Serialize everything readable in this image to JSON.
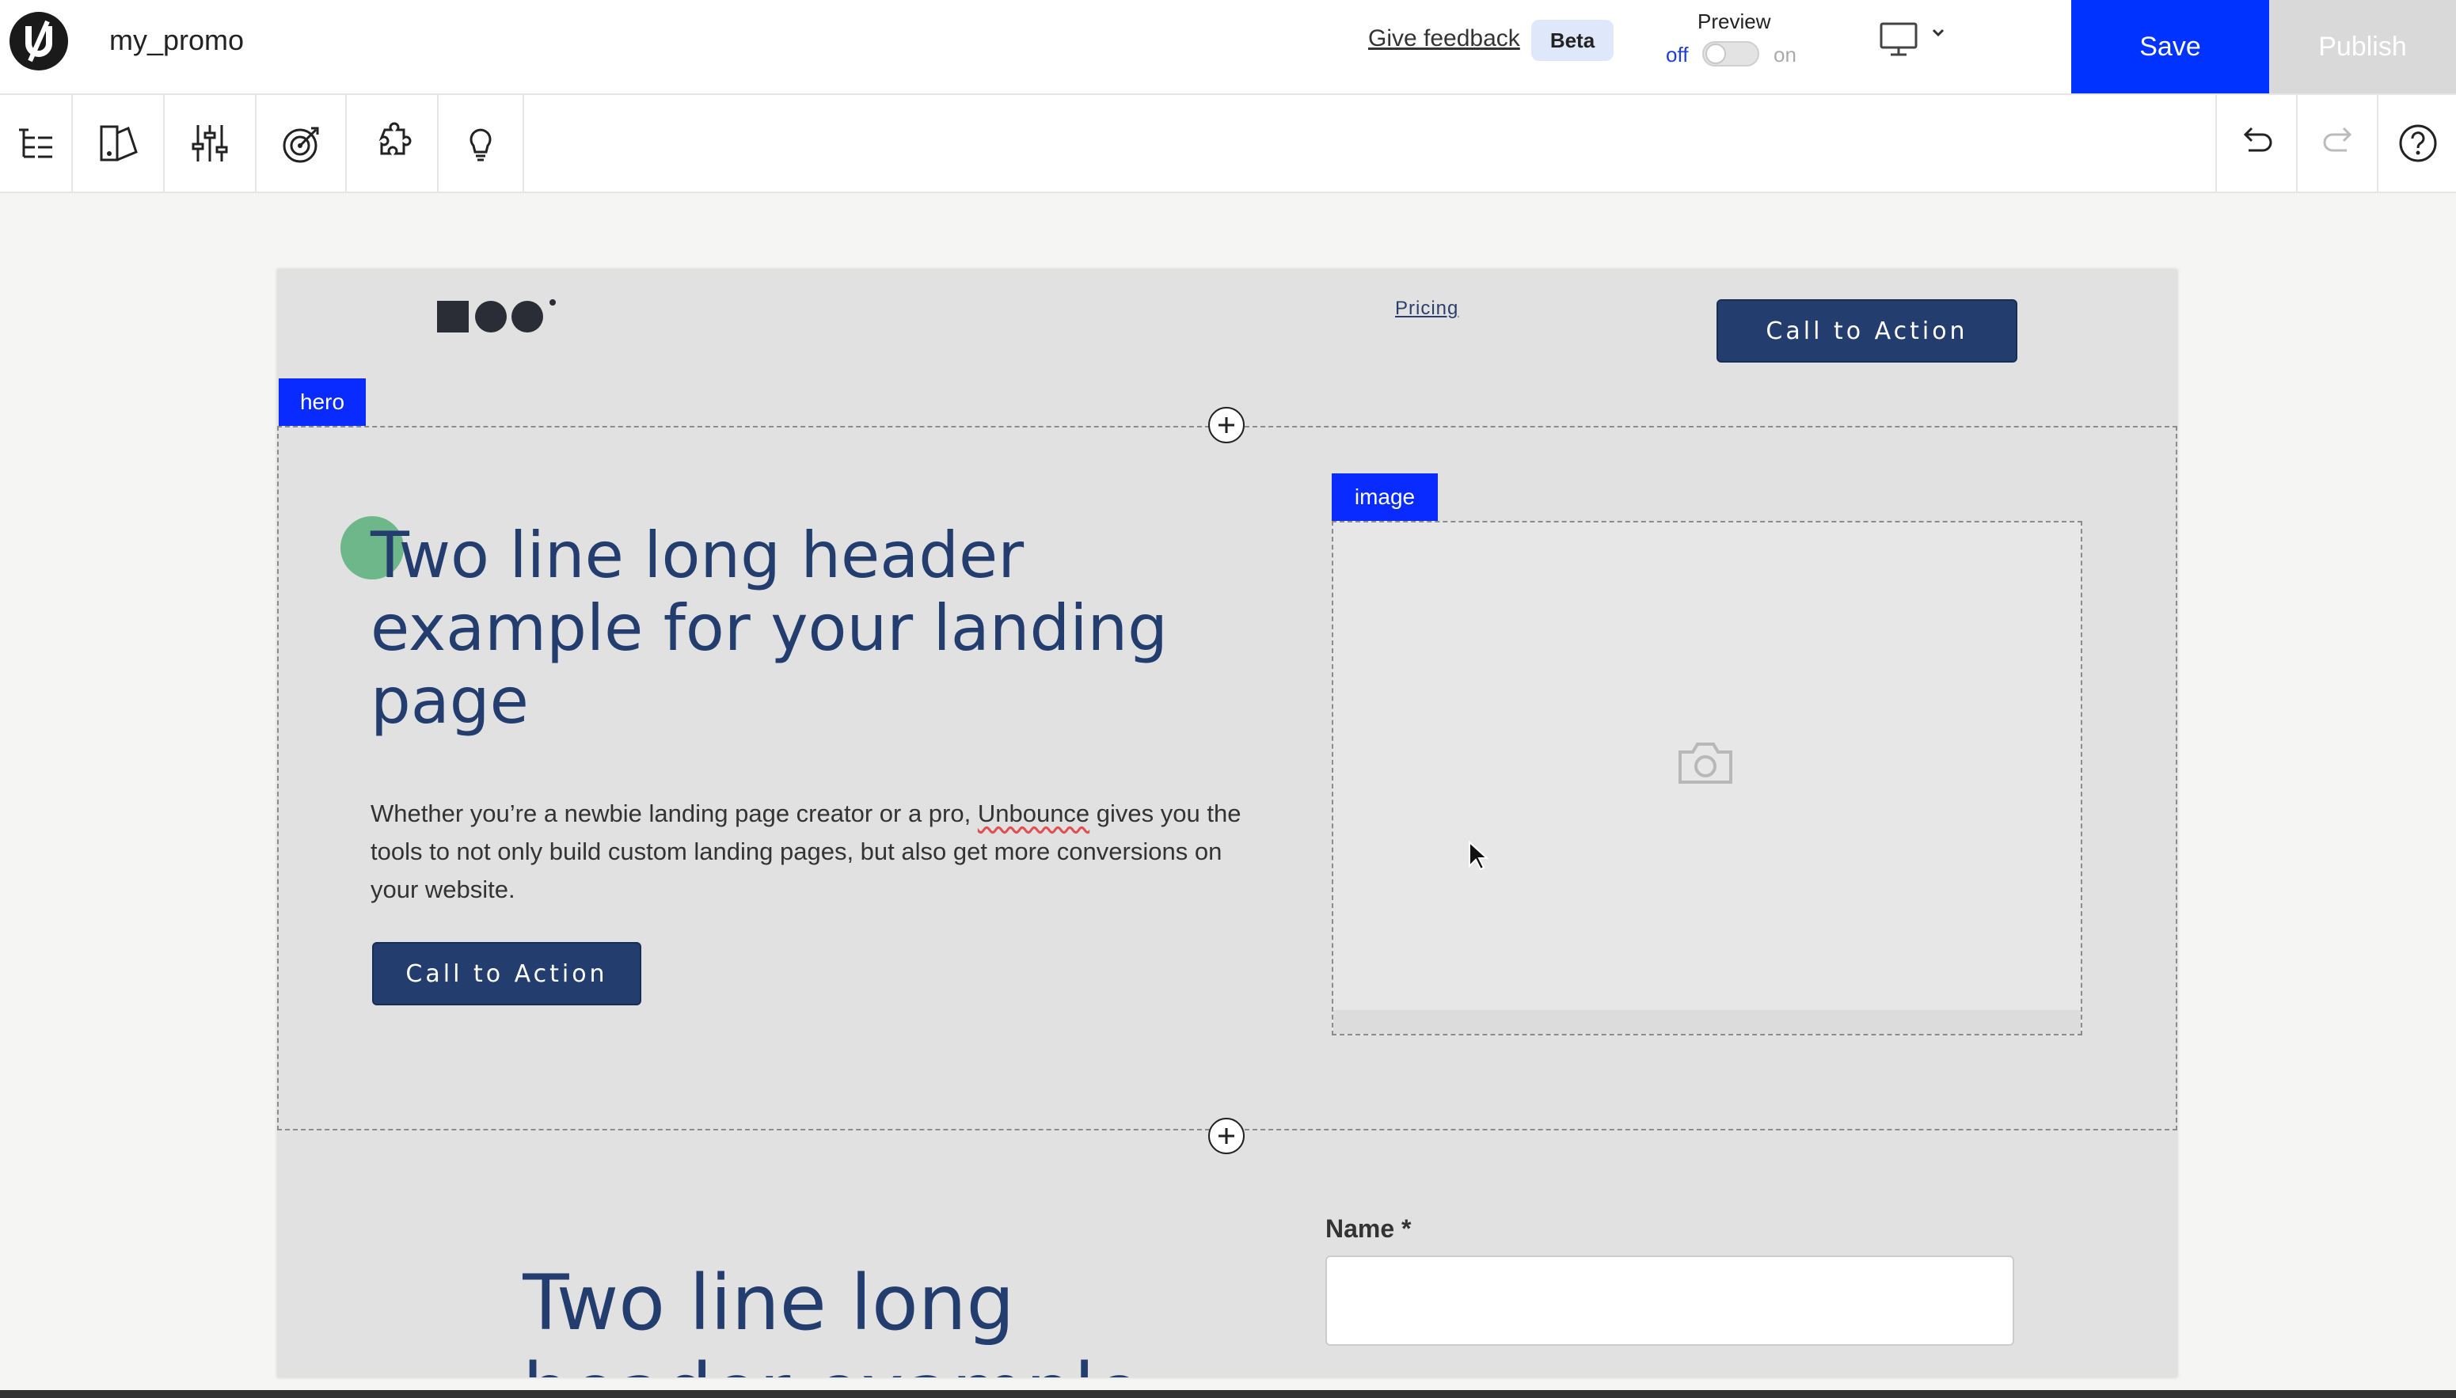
{
  "app": {
    "page_name": "my_promo",
    "feedback_link": "Give feedback",
    "beta_badge": "Beta",
    "preview": {
      "label": "Preview",
      "off": "off",
      "on": "on",
      "state": "off"
    },
    "save": "Save",
    "publish": "Publish",
    "accent_color": "#0033ff"
  },
  "toolbar": {
    "left_tools": [
      "page-tree-icon",
      "style-guide-icon",
      "settings-sliders-icon",
      "goals-target-icon",
      "integrations-puzzle-icon",
      "ideas-lightbulb-icon"
    ],
    "right_tools": [
      "undo-icon",
      "redo-icon",
      "help-icon"
    ]
  },
  "canvas": {
    "nav": {
      "link": "Pricing",
      "cta": "Call to Action"
    },
    "hero": {
      "section_tag": "hero",
      "image_tag": "image",
      "title": "Two line long header example for your landing page",
      "description_before": "Whether you’re a newbie landing page creator or a pro, ",
      "description_brand": "Unbounce",
      "description_after": " gives you the tools to not only build custom landing pages, but also get more conversions on your website.",
      "cta": "Call to Action"
    },
    "section2": {
      "title": "Two line long header example",
      "form_label": "Name *",
      "form_value": ""
    }
  }
}
